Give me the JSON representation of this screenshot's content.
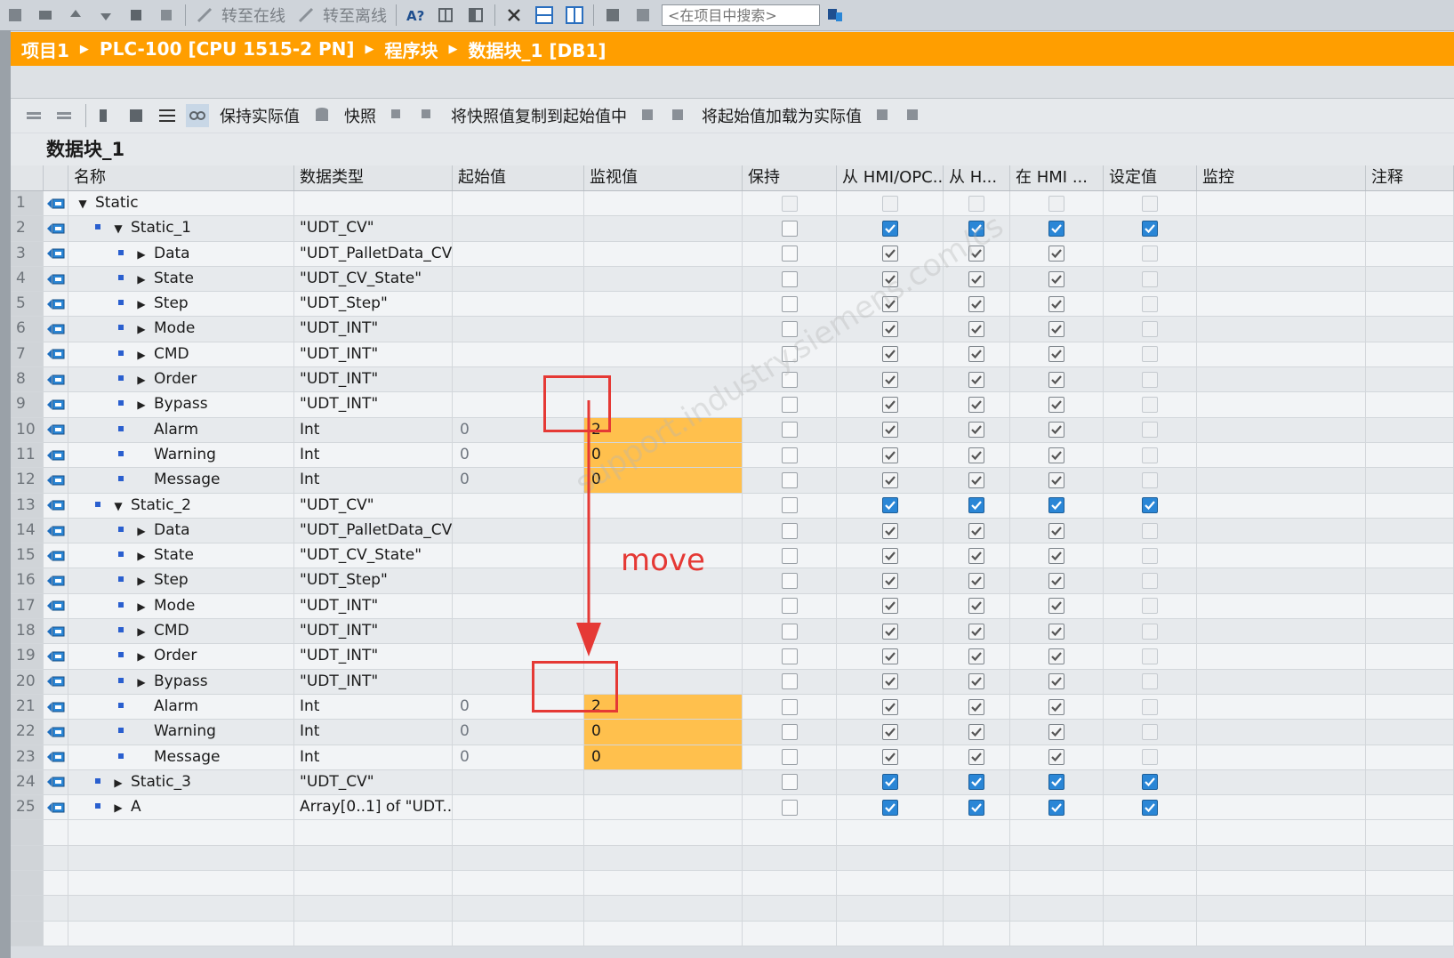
{
  "toolbar": {
    "go_online": "转至在线",
    "go_offline": "转至离线",
    "search_placeholder": "<在项目中搜索>"
  },
  "breadcrumb": [
    "项目1",
    "PLC-100 [CPU 1515-2 PN]",
    "程序块",
    "数据块_1 [DB1]"
  ],
  "editor_toolbar": {
    "keep_actual": "保持实际值",
    "snapshot": "快照",
    "copy_snapshot": "将快照值复制到起始值中",
    "load_start": "将起始值加载为实际值"
  },
  "db_title": "数据块_1",
  "columns": [
    "名称",
    "数据类型",
    "起始值",
    "监视值",
    "保持",
    "从 HMI/OPC..",
    "从 H...",
    "在 HMI ...",
    "设定值",
    "监控",
    "注释"
  ],
  "rows": [
    {
      "n": "1",
      "name": "Static",
      "type": "",
      "start": "",
      "mon": "",
      "level": 0,
      "arrow": "down",
      "bullet": false,
      "cb": [
        0,
        0,
        0,
        0,
        0
      ],
      "blue": false
    },
    {
      "n": "2",
      "name": "Static_1",
      "type": "\"UDT_CV\"",
      "start": "",
      "mon": "",
      "level": 1,
      "arrow": "down",
      "bullet": true,
      "cb": [
        0,
        1,
        1,
        1,
        1
      ],
      "blue": true
    },
    {
      "n": "3",
      "name": "Data",
      "type": "\"UDT_PalletData_CV\"",
      "start": "",
      "mon": "",
      "level": 2,
      "arrow": "right",
      "bullet": true,
      "cb": [
        0,
        1,
        1,
        1,
        0
      ],
      "blue": false
    },
    {
      "n": "4",
      "name": "State",
      "type": "\"UDT_CV_State\"",
      "start": "",
      "mon": "",
      "level": 2,
      "arrow": "right",
      "bullet": true,
      "cb": [
        0,
        1,
        1,
        1,
        0
      ],
      "blue": false
    },
    {
      "n": "5",
      "name": "Step",
      "type": "\"UDT_Step\"",
      "start": "",
      "mon": "",
      "level": 2,
      "arrow": "right",
      "bullet": true,
      "cb": [
        0,
        1,
        1,
        1,
        0
      ],
      "blue": false
    },
    {
      "n": "6",
      "name": "Mode",
      "type": "\"UDT_INT\"",
      "start": "",
      "mon": "",
      "level": 2,
      "arrow": "right",
      "bullet": true,
      "cb": [
        0,
        1,
        1,
        1,
        0
      ],
      "blue": false
    },
    {
      "n": "7",
      "name": "CMD",
      "type": "\"UDT_INT\"",
      "start": "",
      "mon": "",
      "level": 2,
      "arrow": "right",
      "bullet": true,
      "cb": [
        0,
        1,
        1,
        1,
        0
      ],
      "blue": false
    },
    {
      "n": "8",
      "name": "Order",
      "type": "\"UDT_INT\"",
      "start": "",
      "mon": "",
      "level": 2,
      "arrow": "right",
      "bullet": true,
      "cb": [
        0,
        1,
        1,
        1,
        0
      ],
      "blue": false
    },
    {
      "n": "9",
      "name": "Bypass",
      "type": "\"UDT_INT\"",
      "start": "",
      "mon": "",
      "level": 2,
      "arrow": "right",
      "bullet": true,
      "cb": [
        0,
        1,
        1,
        1,
        0
      ],
      "blue": false
    },
    {
      "n": "10",
      "name": "Alarm",
      "type": "Int",
      "start": "0",
      "mon": "2",
      "level": 2,
      "arrow": "none",
      "bullet": true,
      "cb": [
        0,
        1,
        1,
        1,
        0
      ],
      "blue": false
    },
    {
      "n": "11",
      "name": "Warning",
      "type": "Int",
      "start": "0",
      "mon": "0",
      "level": 2,
      "arrow": "none",
      "bullet": true,
      "cb": [
        0,
        1,
        1,
        1,
        0
      ],
      "blue": false
    },
    {
      "n": "12",
      "name": "Message",
      "type": "Int",
      "start": "0",
      "mon": "0",
      "level": 2,
      "arrow": "none",
      "bullet": true,
      "cb": [
        0,
        1,
        1,
        1,
        0
      ],
      "blue": false
    },
    {
      "n": "13",
      "name": "Static_2",
      "type": "\"UDT_CV\"",
      "start": "",
      "mon": "",
      "level": 1,
      "arrow": "down",
      "bullet": true,
      "cb": [
        0,
        1,
        1,
        1,
        1
      ],
      "blue": true
    },
    {
      "n": "14",
      "name": "Data",
      "type": "\"UDT_PalletData_CV\"",
      "start": "",
      "mon": "",
      "level": 2,
      "arrow": "right",
      "bullet": true,
      "cb": [
        0,
        1,
        1,
        1,
        0
      ],
      "blue": false
    },
    {
      "n": "15",
      "name": "State",
      "type": "\"UDT_CV_State\"",
      "start": "",
      "mon": "",
      "level": 2,
      "arrow": "right",
      "bullet": true,
      "cb": [
        0,
        1,
        1,
        1,
        0
      ],
      "blue": false
    },
    {
      "n": "16",
      "name": "Step",
      "type": "\"UDT_Step\"",
      "start": "",
      "mon": "",
      "level": 2,
      "arrow": "right",
      "bullet": true,
      "cb": [
        0,
        1,
        1,
        1,
        0
      ],
      "blue": false
    },
    {
      "n": "17",
      "name": "Mode",
      "type": "\"UDT_INT\"",
      "start": "",
      "mon": "",
      "level": 2,
      "arrow": "right",
      "bullet": true,
      "cb": [
        0,
        1,
        1,
        1,
        0
      ],
      "blue": false
    },
    {
      "n": "18",
      "name": "CMD",
      "type": "\"UDT_INT\"",
      "start": "",
      "mon": "",
      "level": 2,
      "arrow": "right",
      "bullet": true,
      "cb": [
        0,
        1,
        1,
        1,
        0
      ],
      "blue": false
    },
    {
      "n": "19",
      "name": "Order",
      "type": "\"UDT_INT\"",
      "start": "",
      "mon": "",
      "level": 2,
      "arrow": "right",
      "bullet": true,
      "cb": [
        0,
        1,
        1,
        1,
        0
      ],
      "blue": false
    },
    {
      "n": "20",
      "name": "Bypass",
      "type": "\"UDT_INT\"",
      "start": "",
      "mon": "",
      "level": 2,
      "arrow": "right",
      "bullet": true,
      "cb": [
        0,
        1,
        1,
        1,
        0
      ],
      "blue": false
    },
    {
      "n": "21",
      "name": "Alarm",
      "type": "Int",
      "start": "0",
      "mon": "2",
      "level": 2,
      "arrow": "none",
      "bullet": true,
      "cb": [
        0,
        1,
        1,
        1,
        0
      ],
      "blue": false
    },
    {
      "n": "22",
      "name": "Warning",
      "type": "Int",
      "start": "0",
      "mon": "0",
      "level": 2,
      "arrow": "none",
      "bullet": true,
      "cb": [
        0,
        1,
        1,
        1,
        0
      ],
      "blue": false
    },
    {
      "n": "23",
      "name": "Message",
      "type": "Int",
      "start": "0",
      "mon": "0",
      "level": 2,
      "arrow": "none",
      "bullet": true,
      "cb": [
        0,
        1,
        1,
        1,
        0
      ],
      "blue": false
    },
    {
      "n": "24",
      "name": "Static_3",
      "type": "\"UDT_CV\"",
      "start": "",
      "mon": "",
      "level": 1,
      "arrow": "right",
      "bullet": true,
      "cb": [
        0,
        1,
        1,
        1,
        1
      ],
      "blue": true
    },
    {
      "n": "25",
      "name": "A",
      "type": "Array[0..1] of \"UDT...",
      "start": "",
      "mon": "",
      "level": 1,
      "arrow": "right",
      "bullet": true,
      "cb": [
        0,
        1,
        1,
        1,
        1
      ],
      "blue": true
    }
  ],
  "annotation": {
    "label": "move"
  },
  "colors": {
    "accent": "#ff9e00",
    "highlight": "#ffc04d",
    "annotation": "#e53935"
  }
}
